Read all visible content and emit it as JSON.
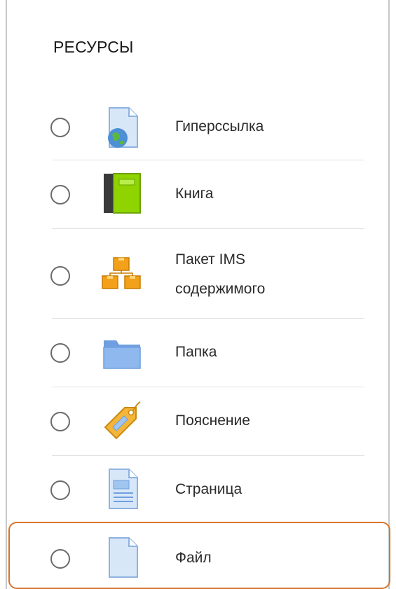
{
  "section": {
    "title": "РЕСУРСЫ"
  },
  "items": [
    {
      "label": "Гиперссылка",
      "icon": "url-globe-icon"
    },
    {
      "label": "Книга",
      "icon": "book-icon"
    },
    {
      "label_line1": "Пакет IMS",
      "label_line2": "содержимого",
      "icon": "ims-package-icon"
    },
    {
      "label": "Папка",
      "icon": "folder-icon"
    },
    {
      "label": "Пояснение",
      "icon": "label-tag-icon"
    },
    {
      "label": "Страница",
      "icon": "page-icon"
    },
    {
      "label": "Файл",
      "icon": "file-icon"
    }
  ],
  "colors": {
    "highlight": "#d8742c",
    "book": "#8fd400",
    "folder": "#6f9fe0",
    "package": "#f3a11b"
  }
}
